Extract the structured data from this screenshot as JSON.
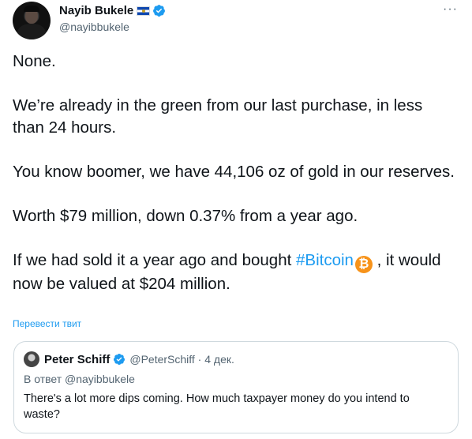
{
  "author": {
    "display_name": "Nayib Bukele",
    "handle": "@nayibbukele",
    "flag_icon": "el-salvador-flag-icon",
    "verified_icon": "verified-badge-icon",
    "more_label": "···"
  },
  "tweet": {
    "paragraph_1": "None.",
    "paragraph_2": "We’re already in the green from our last purchase, in less than 24 hours.",
    "paragraph_3": "You know boomer, we have 44,106 oz of gold in our reserves.",
    "paragraph_4": "Worth $79 million, down 0.37% from a year ago.",
    "paragraph_5_before": "If we had sold it a year ago and bought ",
    "hashtag": "#Bitcoin",
    "paragraph_5_after": " , it would now be valued at $204 million.",
    "bitcoin_glyph": "₿"
  },
  "translate_label": "Перевести твит",
  "quoted_tweet": {
    "display_name": "Peter Schiff",
    "handle_and_date": "@PeterSchiff · 4 дек.",
    "reply_to": "В ответ @nayibbukele",
    "text": "There's a lot more dips coming.  How much taxpayer money do you intend to waste?"
  },
  "colors": {
    "accent": "#1d9bf0",
    "secondary_text": "#536471",
    "border": "#cfd9de",
    "bitcoin": "#f7931a"
  }
}
